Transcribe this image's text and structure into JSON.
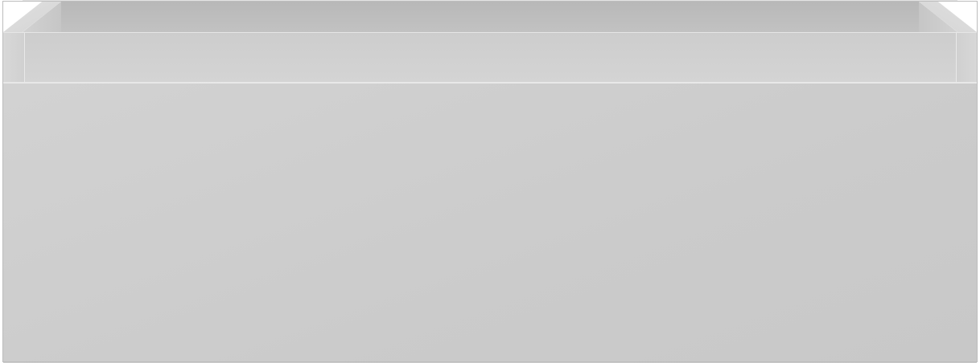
{
  "image": {
    "subject": "",
    "colors": {
      "panel": "#cbcbcb",
      "interior": "#bcbcbc",
      "highlight": "#e6e6e6"
    }
  }
}
